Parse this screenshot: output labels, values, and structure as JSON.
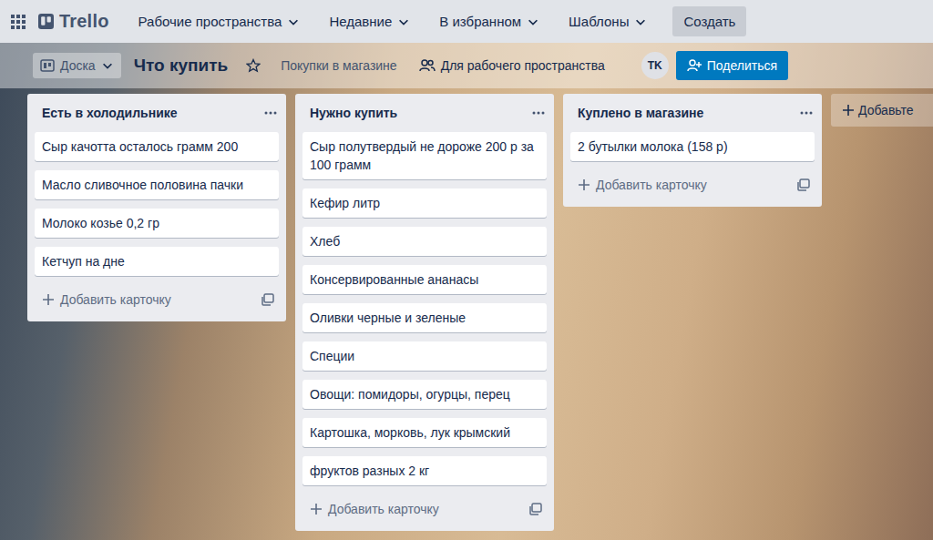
{
  "topbar": {
    "logo": "Trello",
    "menus": [
      {
        "label": "Рабочие пространства"
      },
      {
        "label": "Недавние"
      },
      {
        "label": "В избранном"
      },
      {
        "label": "Шаблоны"
      }
    ],
    "create": "Создать"
  },
  "board": {
    "view": "Доска",
    "title": "Что купить",
    "starred": false,
    "description": "Покупки в магазине",
    "visibility": "Для рабочего пространства",
    "avatar": "TK",
    "share": "Поделиться"
  },
  "lists": [
    {
      "title": "Есть в холодильнике",
      "cards": [
        "Сыр качотта осталось грамм 200",
        "Масло сливочное половина пачки",
        "Молоко козье 0,2 гр",
        "Кетчуп на дне"
      ],
      "add": "Добавить карточку"
    },
    {
      "title": "Нужно купить",
      "cards": [
        "Сыр полутвердый не дороже 200 р за 100 грамм",
        "Кефир литр",
        "Хлеб",
        "Консервированные ананасы",
        "Оливки черные и зеленые",
        "Специи",
        "Овощи: помидоры, огурцы, перец",
        "Картошка, морковь, лук крымский",
        "фруктов разных 2 кг"
      ],
      "add": "Добавить карточку"
    },
    {
      "title": "Куплено в магазине",
      "cards": [
        "2 бутылки молока (158 р)"
      ],
      "add": "Добавить карточку"
    }
  ],
  "add_list": "Добавьте"
}
